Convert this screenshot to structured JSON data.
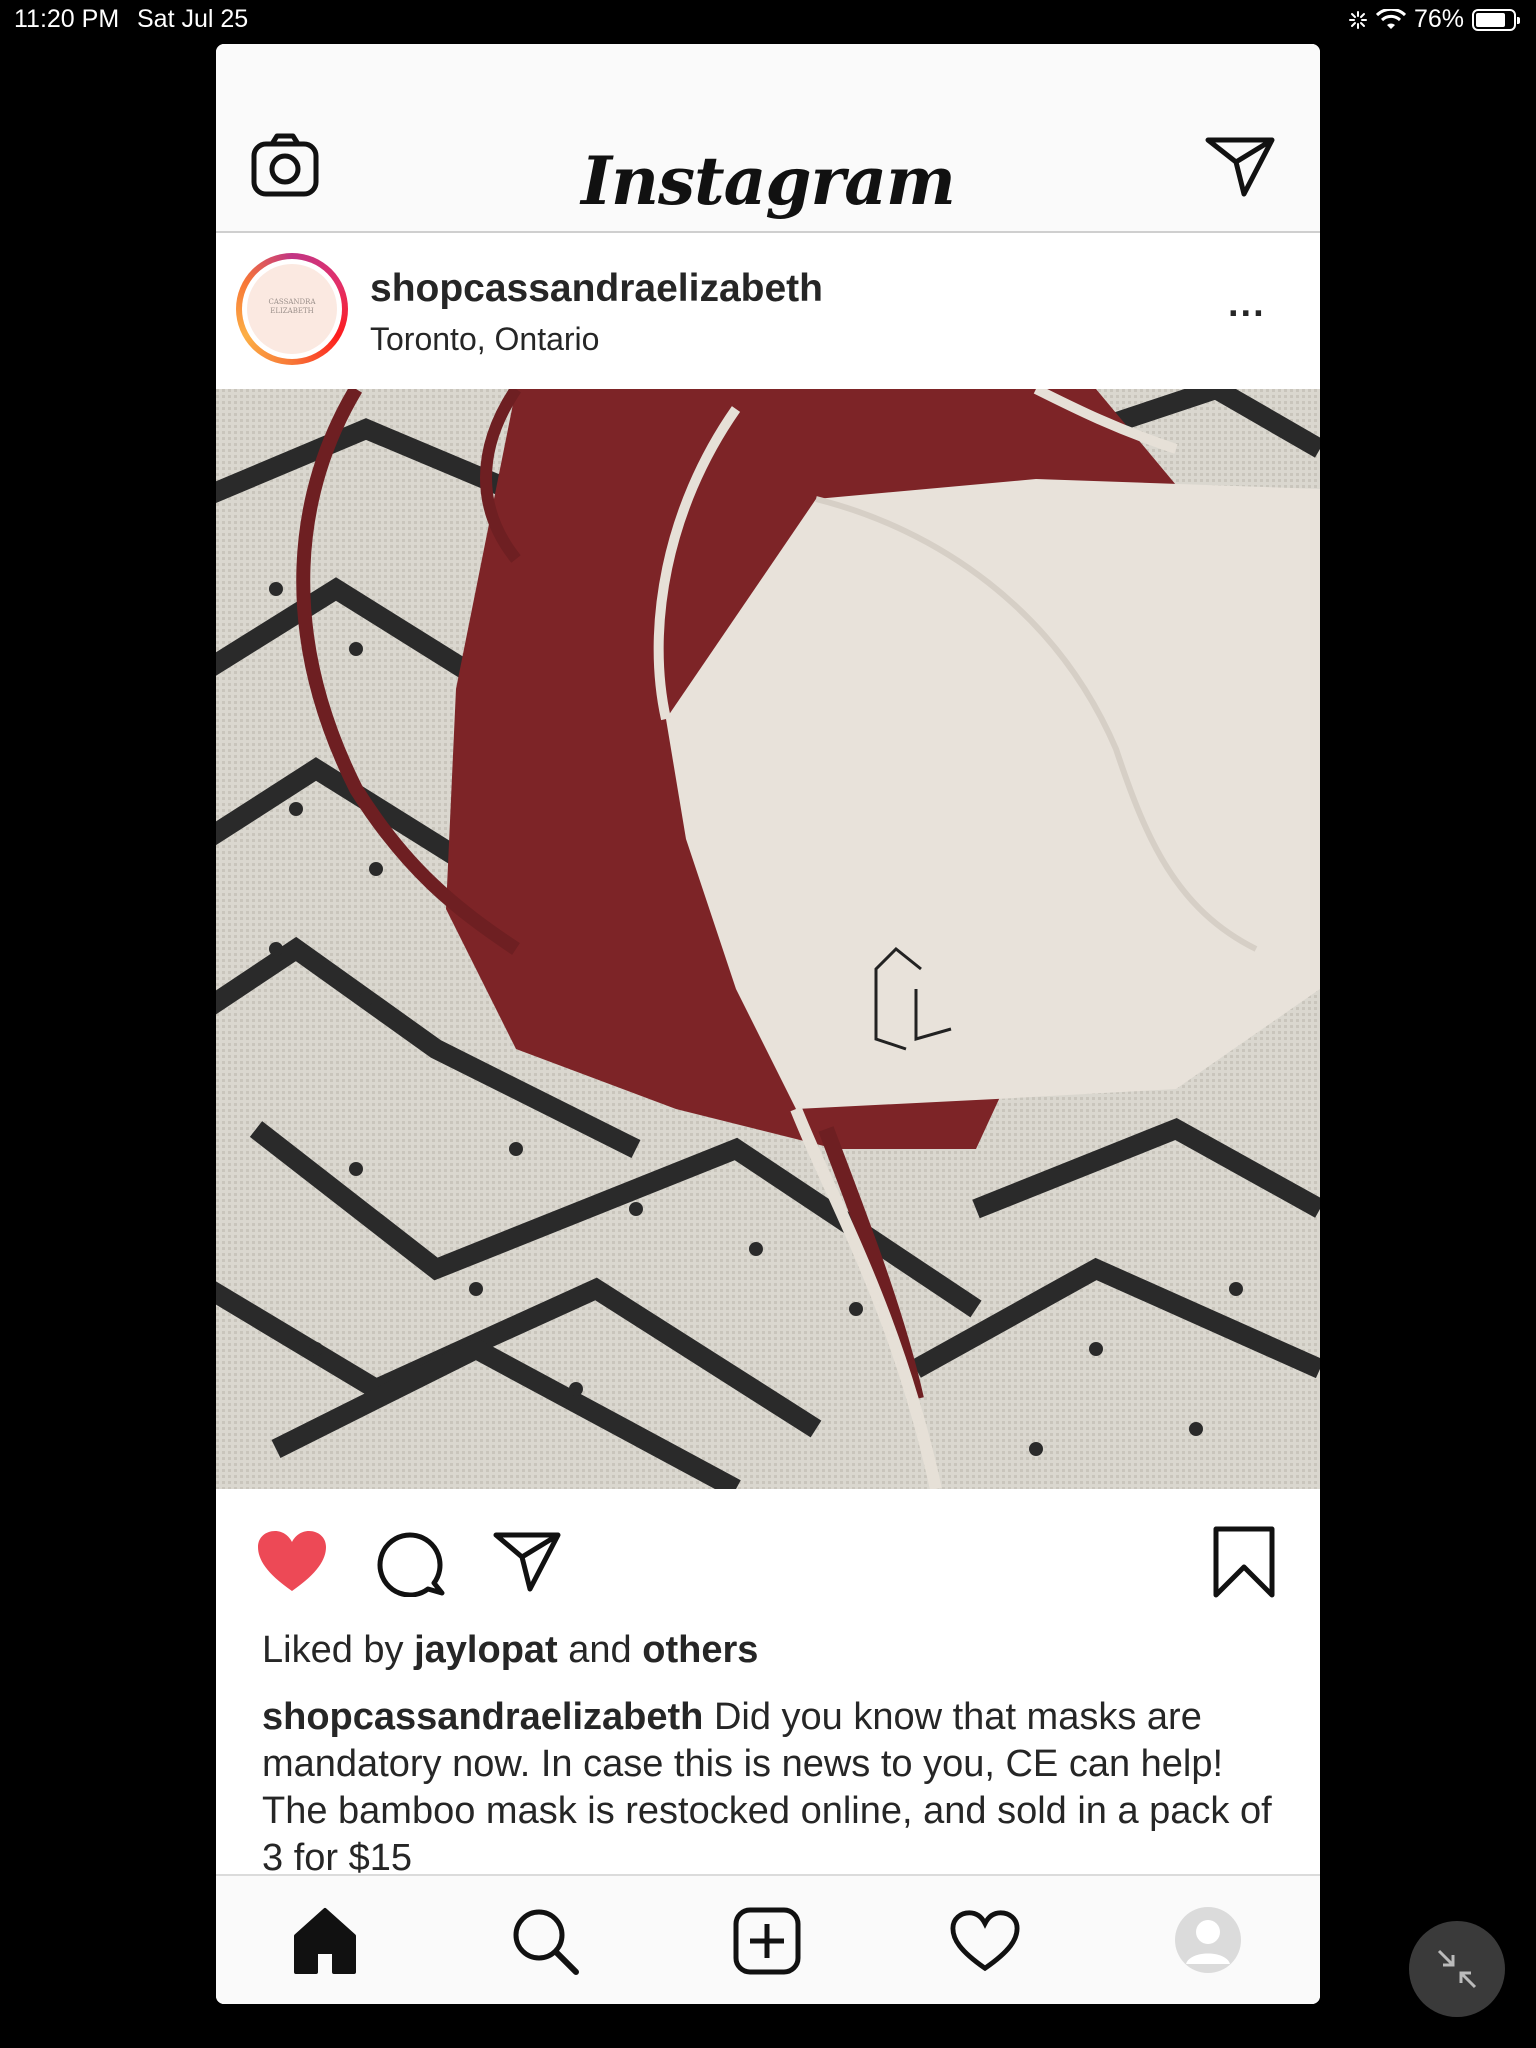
{
  "status_bar": {
    "time": "11:20 PM",
    "date": "Sat Jul 25",
    "battery": "76%",
    "battery_level": 0.76
  },
  "header": {
    "logo": "Instagram",
    "camera_icon": "camera-icon",
    "dm_icon": "direct-message-icon"
  },
  "post": {
    "username": "shopcassandraelizabeth",
    "location": "Toronto, Ontario",
    "more": "...",
    "avatar_text": "CASSANDRA ELIZABETH",
    "liked_prefix": "Liked by",
    "liked_user": "jaylopat",
    "liked_and": "and",
    "liked_others": "others",
    "caption_user": "shopcassandraelizabeth",
    "caption_text": " Did you know that masks are mandatory now. In case this is news to you, CE can help! The bamboo mask is restocked online, and sold in a pack of 3 for $15",
    "liked": true
  },
  "colors": {
    "like_red": "#ed4956",
    "text": "#262626",
    "mask_red": "#7d2427",
    "mask_beige": "#e8e2da"
  },
  "tabbar": {
    "items": [
      "home-icon",
      "search-icon",
      "new-post-icon",
      "activity-heart-icon",
      "profile-icon"
    ]
  }
}
